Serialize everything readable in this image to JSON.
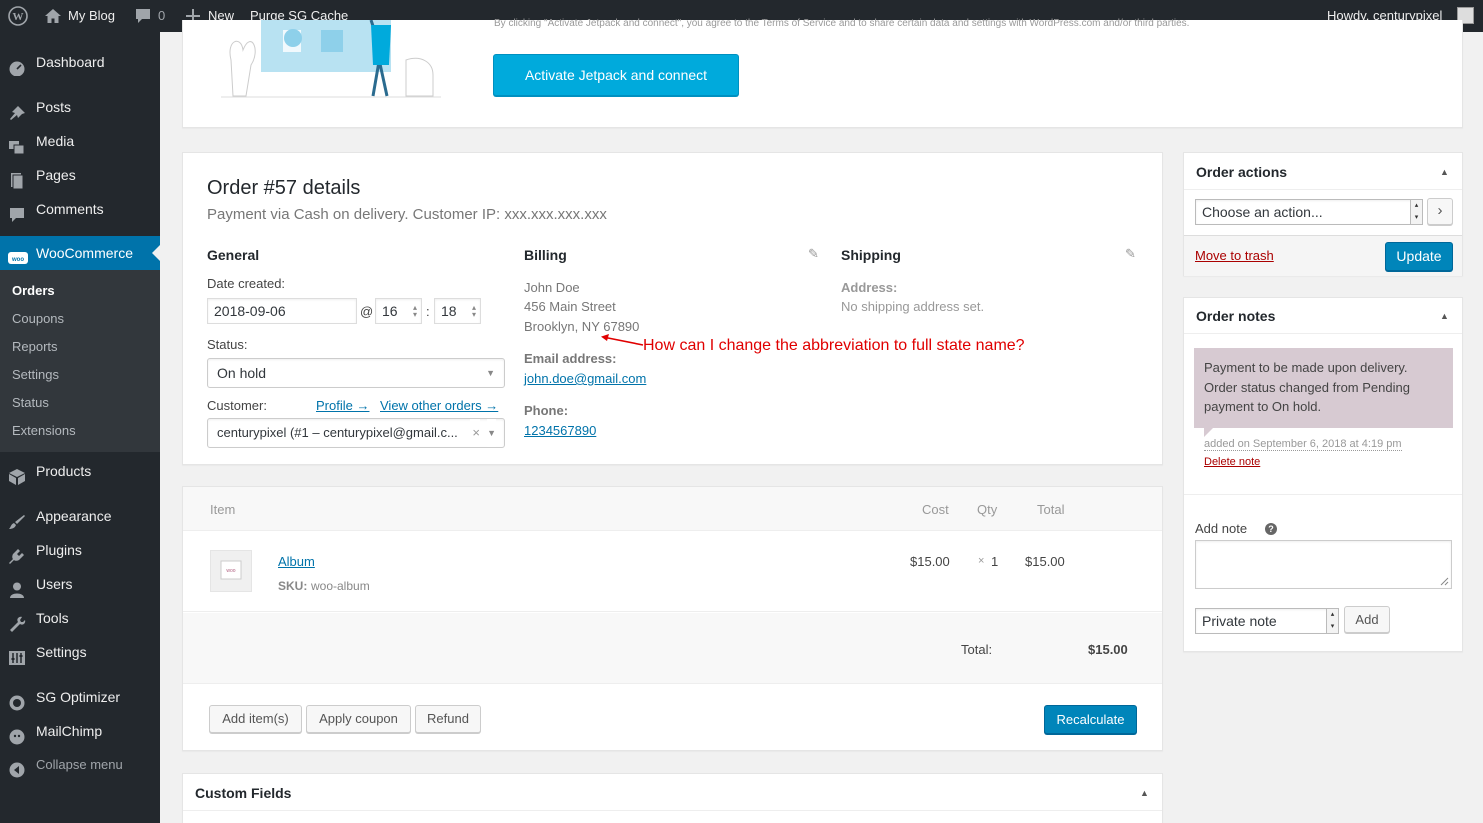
{
  "adminbar": {
    "site_name": "My Blog",
    "comments_count": "0",
    "new_label": "New",
    "purge_label": "Purge SG Cache",
    "howdy": "Howdy, centurypixel"
  },
  "sidebar": {
    "items": [
      {
        "label": "Dashboard"
      },
      {
        "label": "Posts"
      },
      {
        "label": "Media"
      },
      {
        "label": "Pages"
      },
      {
        "label": "Comments"
      },
      {
        "label": "WooCommerce"
      },
      {
        "label": "Products"
      },
      {
        "label": "Appearance"
      },
      {
        "label": "Plugins"
      },
      {
        "label": "Users"
      },
      {
        "label": "Tools"
      },
      {
        "label": "Settings"
      },
      {
        "label": "SG Optimizer"
      },
      {
        "label": "MailChimp"
      },
      {
        "label": "Collapse menu"
      }
    ],
    "woo_sub": [
      "Orders",
      "Coupons",
      "Reports",
      "Settings",
      "Status",
      "Extensions"
    ]
  },
  "jetpack": {
    "notice_text": "By clicking \"Activate Jetpack and connect\", you agree to the Terms of Service and to share certain data and settings with WordPress.com and/or third parties.",
    "button_label": "Activate Jetpack and connect"
  },
  "order": {
    "title": "Order #57 details",
    "subtitle": "Payment via Cash on delivery. Customer IP: xxx.xxx.xxx.xxx",
    "general": {
      "heading": "General",
      "date_label": "Date created:",
      "date_value": "2018-09-06",
      "at": "@",
      "hour": "16",
      "colon": ":",
      "minute": "18",
      "status_label": "Status:",
      "status_value": "On hold",
      "customer_label": "Customer:",
      "profile_link": "Profile →",
      "other_orders_link": "View other orders →",
      "customer_value": "centurypixel (#1 – centurypixel@gmail.c..."
    },
    "billing": {
      "heading": "Billing",
      "name": "John Doe",
      "street": "456 Main Street",
      "city": "Brooklyn, NY 67890",
      "email_label": "Email address:",
      "email": "john.doe@gmail.com",
      "phone_label": "Phone:",
      "phone": "1234567890"
    },
    "shipping": {
      "heading": "Shipping",
      "address_label": "Address:",
      "address_value": "No shipping address set."
    },
    "annotation": "How can I change the abbreviation to full state name?"
  },
  "items_table": {
    "headers": {
      "item": "Item",
      "cost": "Cost",
      "qty": "Qty",
      "total": "Total"
    },
    "rows": [
      {
        "name": "Album",
        "sku_label": "SKU:",
        "sku": "woo-album",
        "cost": "$15.00",
        "qty_x": "×",
        "qty": "1",
        "total": "$15.00"
      }
    ],
    "total_label": "Total:",
    "total_value": "$15.00",
    "buttons": {
      "add_items": "Add item(s)",
      "apply_coupon": "Apply coupon",
      "refund": "Refund",
      "recalculate": "Recalculate"
    }
  },
  "custom_fields": {
    "title": "Custom Fields"
  },
  "order_actions": {
    "title": "Order actions",
    "select_value": "Choose an action...",
    "trash_link": "Move to trash",
    "update_button": "Update"
  },
  "order_notes": {
    "title": "Order notes",
    "note_text": "Payment to be made upon delivery. Order status changed from Pending payment to On hold.",
    "note_meta": "added on September 6, 2018 at 4:19 pm",
    "delete_link": "Delete note",
    "add_note_label": "Add note",
    "help_icon": "?",
    "note_type": "Private note",
    "add_button": "Add"
  },
  "colors": {
    "accent": "#0073aa",
    "wp_dark": "#23282d",
    "jetpack": "#00aadc",
    "annotation": "#e00000",
    "note_bg": "#d7cad2"
  }
}
